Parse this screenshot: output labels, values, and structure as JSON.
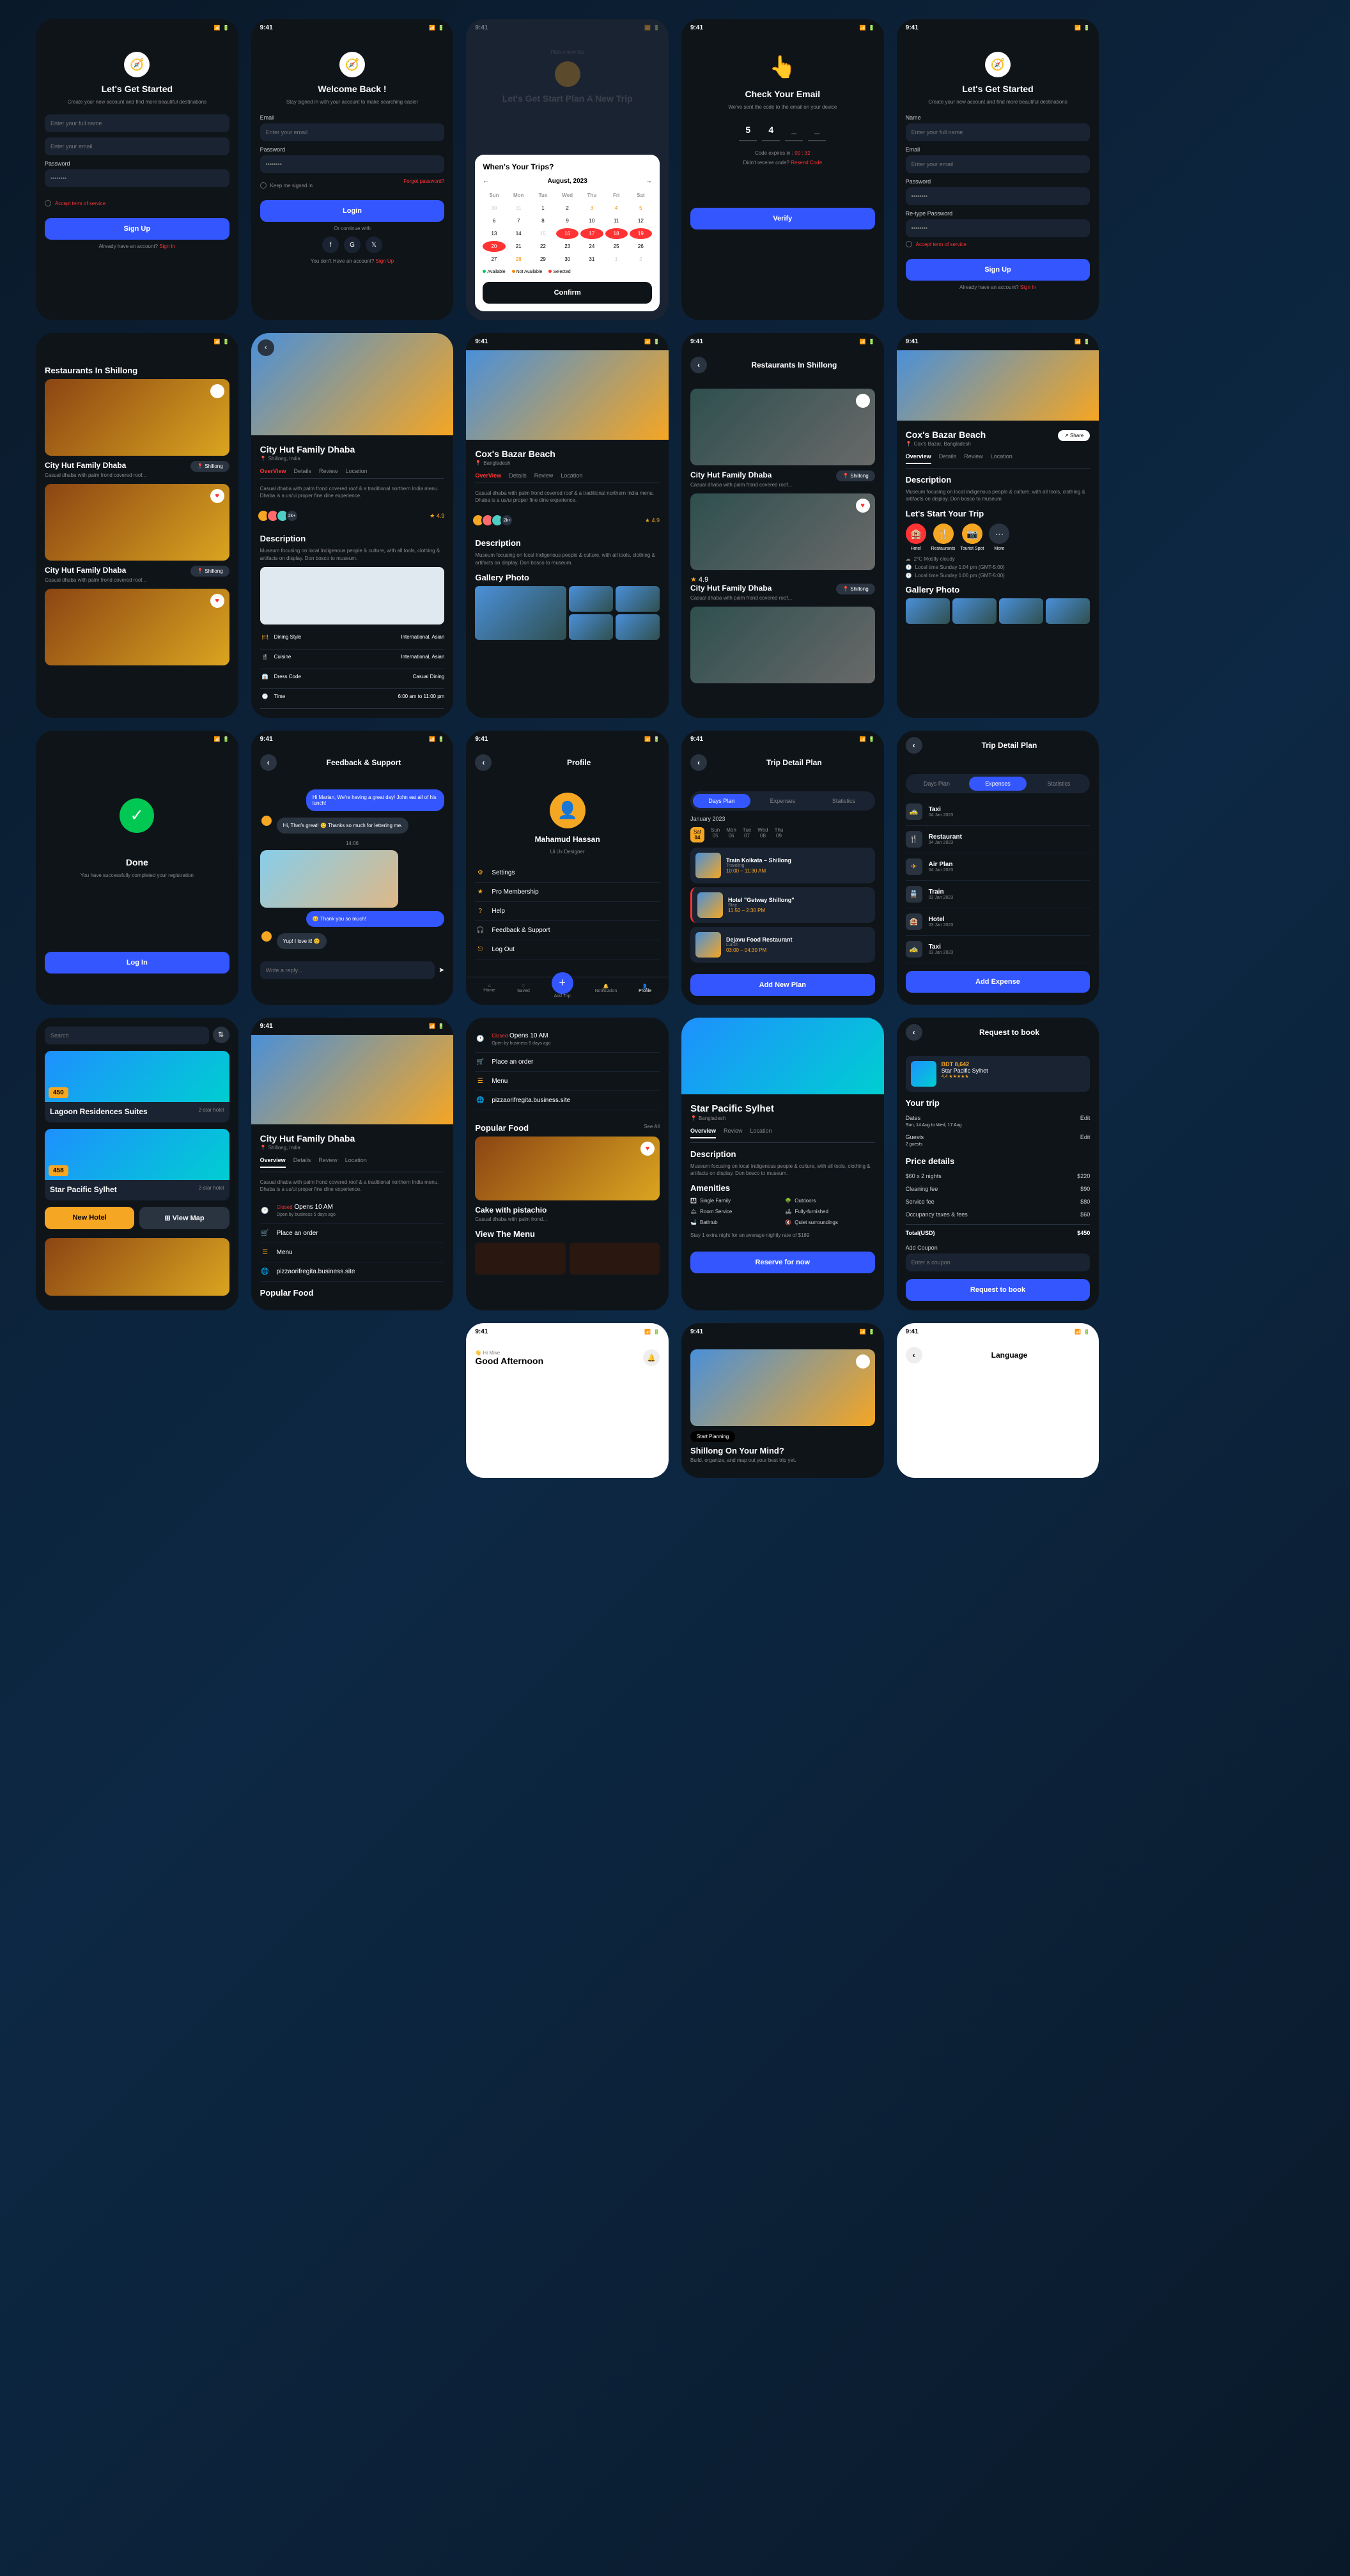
{
  "status_time": "9:41",
  "screens": {
    "signup1": {
      "title": "Let's Get Started",
      "subtitle": "Create your new account and find more beautiful destinations",
      "name_ph": "Enter your full name",
      "email_ph": "Enter your email",
      "pw_ph": "••••••••",
      "terms": "Accept term of service",
      "btn": "Sign Up",
      "footer": "Already have an account?",
      "footer_link": "Sign In"
    },
    "login": {
      "title": "Welcome Back !",
      "subtitle": "Stay signed in with your account to make searching easier",
      "email_label": "Email",
      "email_ph": "Enter your email",
      "pw_label": "Password",
      "pw_val": "••••••••",
      "keep": "Keep me signed in",
      "forgot": "Forgot password?",
      "btn": "Login",
      "or": "Or continue with",
      "footer": "You don't Have an account?",
      "footer_link": "Sign Up"
    },
    "calendar": {
      "plan_title": "Plan a new trip",
      "hero": "Let's Get Start Plan A New Trip",
      "q": "When's Your Trips?",
      "month": "August, 2023",
      "days": [
        "Sun",
        "Mon",
        "Tue",
        "Wed",
        "Thu",
        "Fri",
        "Sat"
      ],
      "leg_a": "Available",
      "leg_na": "Not Available",
      "leg_s": "Selected",
      "btn": "Confirm"
    },
    "otp": {
      "title": "Check Your Email",
      "subtitle": "We've sent the code to the email on your device",
      "d1": "5",
      "d2": "4",
      "expires": "Code expires in :",
      "timer": "00 : 32",
      "resend_q": "Didn't receive code?",
      "resend": "Resend Code",
      "btn": "Verify"
    },
    "signup2": {
      "title": "Let's Get Started",
      "subtitle": "Create your new account and find more beautiful destinations",
      "name_label": "Name",
      "name_ph": "Enter your full name",
      "email_label": "Email",
      "email_ph": "Enter your email",
      "pw_label": "Password",
      "rpw_label": "Re-type Password",
      "pw_val": "••••••••",
      "terms": "Accept term of service",
      "btn": "Sign Up",
      "footer": "Already have an account?",
      "footer_link": "Sign In"
    },
    "rest_list": {
      "header": "Restaurants In Shillong",
      "items": [
        {
          "name": "City Hut Family Dhaba",
          "loc": "Shillong",
          "desc": "Casual dhaba with palm frond covered roof..."
        },
        {
          "name": "City Hut Family Dhaba",
          "loc": "Shillong",
          "desc": "Casual dhaba with palm frond covered roof..."
        }
      ]
    },
    "detail1": {
      "name": "City Hut Family Dhaba",
      "loc": "Shillong, India",
      "tabs": [
        "OverView",
        "Details",
        "Review",
        "Location"
      ],
      "desc": "Casual dhaba with palm frond covered roof & a traditional northern India menu. Dhaba is a us/ui proper fine dine experience.",
      "count": "2k+",
      "rating": "4.9",
      "desc_title": "Description",
      "desc2": "Museum focusing on local Indigenous people & culture, with all tools, clothing & artifacts on display. Don bosco to museum.",
      "info": [
        [
          "Dining Style",
          "International, Asian"
        ],
        [
          "Cuisine",
          "International, Asian"
        ],
        [
          "Dress Code",
          "Casual Dining"
        ],
        [
          "Time",
          "6:00 am to 11:00 pm"
        ]
      ]
    },
    "detail2": {
      "name": "Cox's Bazar Beach",
      "loc": "Bangladesh",
      "tabs": [
        "OverView",
        "Details",
        "Review",
        "Location"
      ],
      "desc": "Casual dhaba with palm frond covered roof & a traditional northern India menu. Dhaba is a us/ui proper fine dine experience.",
      "count": "2k+",
      "rating": "4.9",
      "desc_title": "Description",
      "desc2": "Museum focusing on local Indigenous people & culture, with all tools, clothing & artifacts on display. Don bosco to museum.",
      "gallery": "Gallery Photo"
    },
    "rest_list2": {
      "header": "Restaurants In Shillong",
      "items": [
        {
          "name": "City Hut Family Dhaba",
          "loc": "Shillong",
          "desc": "Casual dhaba with palm frond covered roof..."
        },
        {
          "name": "City Hut Family Dhaba",
          "loc": "Shillong",
          "desc": "Casual dhaba with palm frond covered roof...",
          "rating": "4.9"
        }
      ]
    },
    "cox": {
      "name": "Cox's Bazar Beach",
      "loc": "Cox's Bazar, Bangladesh",
      "share": "Share",
      "tabs": [
        "Overview",
        "Details",
        "Review",
        "Location"
      ],
      "desc_title": "Description",
      "desc": "Museum focusing on local indigenous people & culture, with all tools, clothing & artifacts on display. Don bosco to museum",
      "start": "Let's Start Your Trip",
      "cats": [
        "Hotel",
        "Restaurants",
        "Tourist Spot",
        "More"
      ],
      "weather": "2°C Mostly cloudy",
      "time1": "Local time Sunday 1:04 pm (GMT-5:00)",
      "time2": "Local time Sunday 1:06 pm (GMT-5:00)",
      "gallery": "Gallery Photo"
    },
    "done": {
      "title": "Done",
      "subtitle": "You have successfully completed your registration",
      "btn": "Log In"
    },
    "feedback": {
      "header": "Feedback & Support",
      "msg1": "Hi Marian, We're having a great day! John eat all of his lunch!",
      "msg2": "Hi, That's great! 😊 Thanks so much for lettering me.",
      "time": "14:06",
      "msg3": "😊 Thank you so much!",
      "msg4": "Yup! I love it! 😊",
      "input": "Write a reply..."
    },
    "profile": {
      "header": "Profile",
      "name": "Mahamud Hassan",
      "role": "Ui Ux Designer",
      "items": [
        "Settings",
        "Pro Membership",
        "Help",
        "Feedback & Support",
        "Log Out"
      ],
      "nav": [
        "Home",
        "Saved",
        "Add Trip",
        "Notification",
        "Profile"
      ]
    },
    "trip_plan": {
      "header": "Trip Detail Plan",
      "tabs": [
        "Days Plan",
        "Expenses",
        "Statistics"
      ],
      "month": "January 2023",
      "days": [
        [
          "Sat",
          "04"
        ],
        [
          "Sun",
          "05"
        ],
        [
          "Mon",
          "06"
        ],
        [
          "Tue",
          "07"
        ],
        [
          "Wed",
          "08"
        ],
        [
          "Thu",
          "09"
        ]
      ],
      "items": [
        {
          "name": "Train Kolkata – Shillong",
          "type": "Traveling",
          "time": "10:00 – 11:30 AM"
        },
        {
          "name": "Hotel \"Getway Shillong\"",
          "type": "Stay",
          "time": "11:50 – 2:30 PM"
        },
        {
          "name": "Dejavu Food Restaurant",
          "type": "Lunch",
          "time": "03:00 – 04:30 PM"
        }
      ],
      "btn": "Add New Plan"
    },
    "expenses": {
      "header": "Trip Detail Plan",
      "tabs": [
        "Days Plan",
        "Expenses",
        "Statistics"
      ],
      "items": [
        [
          "Taxi",
          "04 Jan 2023"
        ],
        [
          "Restaurant",
          "04 Jan 2023"
        ],
        [
          "Air Plan",
          "04 Jan 2023"
        ],
        [
          "Train",
          "03 Jan 2023"
        ],
        [
          "Hotel",
          "03 Jan 2023"
        ],
        [
          "Taxi",
          "03 Jan 2023"
        ]
      ],
      "btn": "Add Expense"
    },
    "hotels": {
      "search": "Search",
      "h1": "Lagoon Residences Suites",
      "h1r": "2-star hotel",
      "p1": "450",
      "h2": "Star Pacific Sylhet",
      "h2r": "2-star hotel",
      "p2": "458",
      "new": "New Hotel",
      "map": "View Map"
    },
    "detail3": {
      "name": "City Hut Family Dhaba",
      "loc": "Shillong, India",
      "tabs": [
        "Overview",
        "Details",
        "Review",
        "Location"
      ],
      "desc": "Casual dhaba with palm frond covered roof & a traditional northern India menu. Dhaba is a us/ui proper fine dine experience.",
      "closed": "Closed",
      "opens": "Opens 10 AM",
      "open_by": "Open by business 5 days ago",
      "order": "Place an order",
      "menu": "Menu",
      "site": "pizzaorifregita.business.site",
      "popular": "Popular Food"
    },
    "resto_detail": {
      "closed": "Closed",
      "opens": "Opens 10 AM",
      "open_by": "Open by business 5 days ago",
      "order": "Place an order",
      "menu": "Menu",
      "site": "pizzaorifregita.business.site",
      "popular": "Popular Food",
      "seeall": "See All",
      "food": "Cake with pistachio",
      "food_desc": "Casual dhaba with palm frond...",
      "view_menu": "View The Menu"
    },
    "star": {
      "name": "Star Pacific Sylhet",
      "loc": "Bangladesh",
      "tabs": [
        "Overview",
        "Review",
        "Location"
      ],
      "desc_title": "Description",
      "desc": "Museum focusing on local Indigenous people & culture, with all tools, clothing & artifacts on display. Don bosco to museum.",
      "amen_title": "Amenities",
      "amen": [
        "Single Family",
        "Outdoors",
        "Room Service",
        "Fully-furnished",
        "Bathtub",
        "Quiet surroundings"
      ],
      "extra": "Stay 1 extra night for an average nightly rate of $189",
      "btn": "Reserve for now"
    },
    "booking": {
      "header": "Request to book",
      "price": "BDT 8,642",
      "hotel": "Star Pacific Sylhet",
      "rating": "4.4 ★★★★★",
      "trip": "Your trip",
      "dates": "Dates",
      "dates_v": "Sun, 14 Aug to Wed, 17 Aug",
      "guests": "Guests",
      "guests_v": "2 guests",
      "edit": "Edit",
      "pd": "Price details",
      "r1": "$60 x 2 nights",
      "r1v": "$220",
      "r2": "Cleaning fee",
      "r2v": "$90",
      "r3": "Service fee",
      "r3v": "$80",
      "r4": "Occupancy taxes & fees",
      "r4v": "$60",
      "total": "Total(USD)",
      "total_v": "$450",
      "coupon": "Add Coupon",
      "coupon_ph": "Enter a coupon",
      "btn": "Request to book"
    },
    "home": {
      "greeting_pre": "Hi Mike",
      "greeting": "Good Afternoon"
    },
    "shillong": {
      "chip": "Start Planning",
      "title": "Shillong On Your Mind?",
      "desc": "Build, organize, and map out your best trip yet."
    },
    "lang": {
      "header": "Language"
    }
  }
}
